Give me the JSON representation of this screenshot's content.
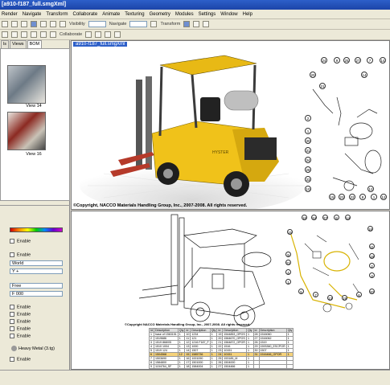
{
  "window": {
    "title": "[a910-f187_full.smgXml]"
  },
  "menu": [
    "Render",
    "Navigate",
    "Transform",
    "Collaborate",
    "Animate",
    "Texturing",
    "Geometry",
    "Modules",
    "Settings",
    "Window",
    "Help"
  ],
  "toolbar1": {
    "visibility_label": "Visibility",
    "navigate_label": "Navigate",
    "transform_label": "Transform"
  },
  "toolbar2": {
    "collaborate_label": "Collaborate"
  },
  "left_panel": {
    "tabs": [
      "ls",
      "Views",
      "BOM"
    ],
    "thumbs": [
      {
        "caption": "View 14"
      },
      {
        "caption": "View 16"
      }
    ],
    "props": {
      "enable_1": "Enable",
      "enable_2": "Enable",
      "world": "World",
      "y_axis": "Y +",
      "free": "Free",
      "f000": "F 000",
      "enables": [
        "Enable",
        "Enable",
        "Enable",
        "Enable",
        "Enable"
      ],
      "material": "Heavy Metal (3.tg)",
      "enable_last": "Enable"
    }
  },
  "top_view": {
    "title": "a910-f187_full.smgXml",
    "copyright": "©Copyright, NACCO Materials Handling Group, Inc., 2007-2008. All rights reserved.",
    "brand": "HYSTER"
  },
  "callouts_top": [
    "24",
    "9",
    "25",
    "27",
    "7",
    "14",
    "20",
    "14",
    "21",
    "2",
    "1",
    "30",
    "31",
    "34",
    "28",
    "33",
    "10",
    "15",
    "23",
    "22",
    "8",
    "1",
    "12",
    "12"
  ],
  "callouts_bottom": [
    "16",
    "34",
    "27",
    "8",
    "14",
    "15",
    "16",
    "9",
    "11",
    "21",
    "18",
    "4",
    "2",
    "1",
    "3",
    "5",
    "7",
    "13",
    "19",
    "6",
    "20"
  ],
  "bottom_view": {
    "copyright": "©Copyright NACCO Materials Handling Group, Inc., 2007-2008. All rights reserved."
  },
  "bom_table": {
    "headers": [
      "Id",
      "Description",
      "Qty"
    ],
    "rows": [
      [
        "1",
        "hase of 1563151",
        "1",
        "10",
        "1234",
        "1",
        "19",
        "1544853_OPOS",
        "1",
        "28",
        "1516060",
        "1"
      ],
      [
        "2",
        "1519686",
        "1",
        "11",
        "121",
        "1",
        "20",
        "1564670_OPOS",
        "1",
        "27",
        "1516062",
        "1"
      ],
      [
        "3",
        "1519 868/05",
        "1",
        "12",
        "1216 F187_F",
        "1",
        "21",
        "1564872_OPOR",
        "1",
        "26",
        "1519",
        "1"
      ],
      [
        "4",
        "1510 1004",
        "1",
        "13",
        "1000",
        "1",
        "22",
        "1516",
        "1",
        "29",
        "1593360_ESCPOR",
        "1"
      ],
      [
        "5",
        "1519 124",
        "1",
        "14",
        "1507",
        "1",
        "23",
        "10151",
        "1",
        "30",
        "1507",
        "1"
      ],
      [
        "6",
        "1504568",
        "12",
        "15",
        "1585736",
        "1",
        "24",
        "10151",
        "1",
        "31",
        "1516466_OPOR",
        "1"
      ],
      [
        "7",
        "1503690",
        "1",
        "16",
        "1001090",
        "1",
        "25",
        "153185_M",
        "1",
        "",
        "",
        ""
      ],
      [
        "8",
        "1584800",
        "1",
        "17",
        "1501000",
        "1",
        "26",
        "1504000",
        "1",
        "",
        "",
        ""
      ],
      [
        "9",
        "1154764_SF",
        "1",
        "18",
        "1584004",
        "1",
        "27",
        "1504466",
        "1",
        "",
        "",
        ""
      ]
    ]
  }
}
